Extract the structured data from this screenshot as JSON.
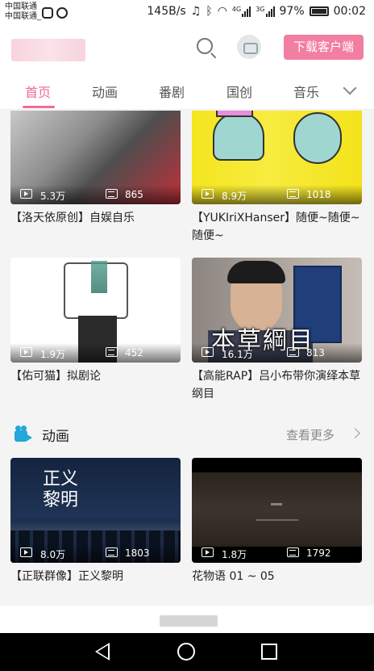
{
  "status_bar": {
    "carrier1": "中国联通",
    "carrier2": "中国联通_",
    "speed": "145B/s",
    "signal1_tag": "4G",
    "signal2_tag": "3G",
    "battery_pct": "97%",
    "time": "00:02"
  },
  "header": {
    "download_label": "下载客户端"
  },
  "tabs": [
    {
      "label": "首页"
    },
    {
      "label": "动画"
    },
    {
      "label": "番剧"
    },
    {
      "label": "国创"
    },
    {
      "label": "音乐"
    }
  ],
  "videos": [
    {
      "views": "5.3万",
      "danmaku": "865",
      "title": "【洛天依原创】自娱自乐",
      "colors": [
        "#c9c9c9",
        "#6b6b6b",
        "#b31f28"
      ]
    },
    {
      "views": "8.9万",
      "danmaku": "1018",
      "title": "【YUKIriXHanser】随便~随便~随便~",
      "colors": [
        "#f5e722",
        "#9fd6d0",
        "#e68fd8"
      ]
    },
    {
      "views": "1.9万",
      "danmaku": "452",
      "title": "【佑可猫】拟剧论",
      "colors": [
        "#ffffff",
        "#2f2f2f",
        "#4fa08e"
      ]
    },
    {
      "views": "16.1万",
      "danmaku": "813",
      "title": "【高能RAP】吕小布带你演绎本草纲目",
      "colors": [
        "#a89e94",
        "#2a2b33",
        "#6d6864"
      ],
      "overlay_text": "本草綱目"
    },
    {
      "views": "8.0万",
      "danmaku": "1803",
      "title": "【正联群像】正义黎明",
      "colors": [
        "#0f1e36",
        "#34496b",
        "#e8e4d8"
      ],
      "overlay_text": "正义\n黎明"
    },
    {
      "views": "1.8万",
      "danmaku": "1792",
      "title": "花物语 01 ~ 05",
      "colors": [
        "#1b1712",
        "#3b352e",
        "#000000"
      ]
    }
  ],
  "section": {
    "title": "动画",
    "more_label": "查看更多"
  },
  "icons": {
    "search": "search-icon",
    "avatar": "avatar-icon",
    "chevron": "chevron-down-icon",
    "play": "play-count-icon",
    "danmaku": "danmaku-icon",
    "section": "video-camera-icon",
    "nav_back": "back-icon",
    "nav_home": "home-icon",
    "nav_recent": "recent-apps-icon"
  },
  "accent_color": "#f06d93"
}
